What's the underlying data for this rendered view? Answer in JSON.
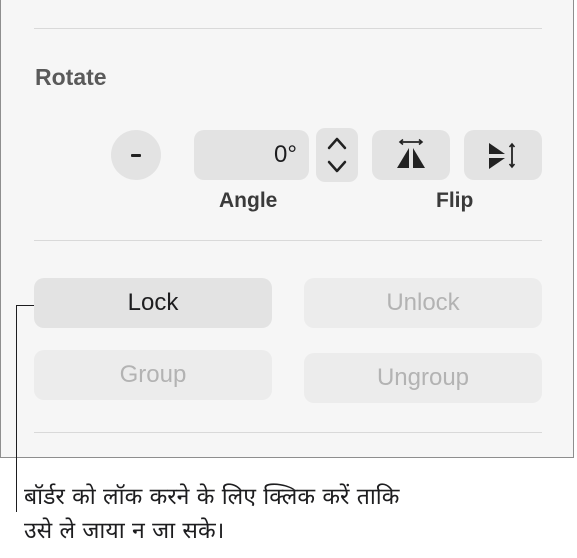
{
  "rotate": {
    "title": "Rotate",
    "angle_value": "0°",
    "angle_label": "Angle",
    "flip_label": "Flip"
  },
  "arrange": {
    "lock_label": "Lock",
    "unlock_label": "Unlock",
    "group_label": "Group",
    "ungroup_label": "Ungroup"
  },
  "callout": {
    "line1": "बॉर्डर को लॉक करने के लिए क्लिक करें ताकि",
    "line2": "उसे ले जाया न जा सके।"
  }
}
